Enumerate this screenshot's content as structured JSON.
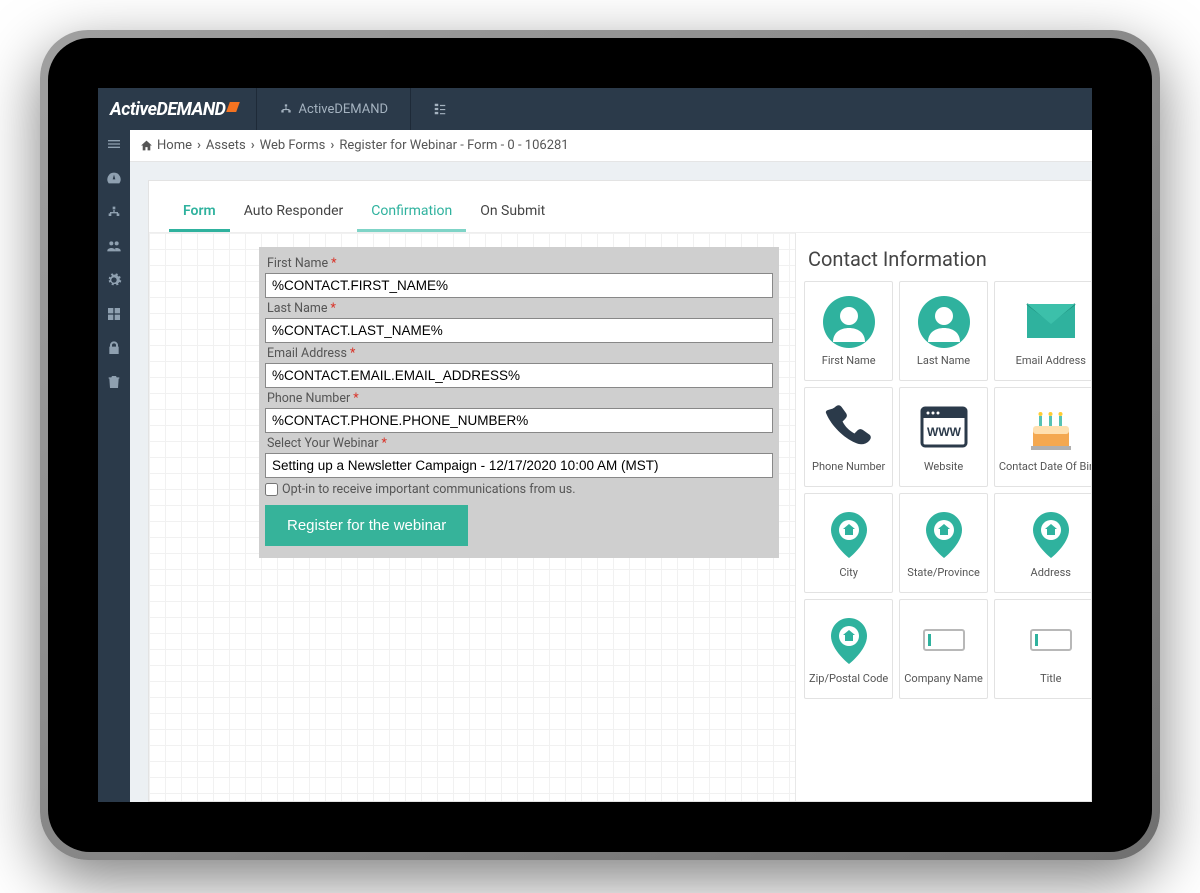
{
  "brand": {
    "name_a": "Active",
    "name_b": "DEMAND"
  },
  "topnav": {
    "item1": "ActiveDEMAND"
  },
  "breadcrumb": {
    "home": "Home",
    "assets": "Assets",
    "webforms": "Web Forms",
    "current": "Register for Webinar - Form - 0 - 106281"
  },
  "tabs": {
    "form": "Form",
    "autoresponder": "Auto Responder",
    "confirmation": "Confirmation",
    "onsubmit": "On Submit"
  },
  "form": {
    "first_name": {
      "label": "First Name",
      "value": "%CONTACT.FIRST_NAME%"
    },
    "last_name": {
      "label": "Last Name",
      "value": "%CONTACT.LAST_NAME%"
    },
    "email": {
      "label": "Email Address",
      "value": "%CONTACT.EMAIL.EMAIL_ADDRESS%"
    },
    "phone": {
      "label": "Phone Number",
      "value": "%CONTACT.PHONE.PHONE_NUMBER%"
    },
    "webinar": {
      "label": "Select Your Webinar",
      "value": "Setting up a Newsletter Campaign - 12/17/2020 10:00 AM (MST)"
    },
    "optin": "Opt-in to receive important communications from us.",
    "submit": "Register for the webinar"
  },
  "sidepanel": {
    "title": "Contact Information",
    "tiles": [
      {
        "label": "First Name",
        "icon": "person"
      },
      {
        "label": "Last Name",
        "icon": "person"
      },
      {
        "label": "Email Address",
        "icon": "envelope"
      },
      {
        "label": "Phone Number",
        "icon": "phone"
      },
      {
        "label": "Website",
        "icon": "www"
      },
      {
        "label": "Contact Date Of Birth",
        "icon": "cake"
      },
      {
        "label": "City",
        "icon": "pin"
      },
      {
        "label": "State/Province",
        "icon": "pin"
      },
      {
        "label": "Address",
        "icon": "pin"
      },
      {
        "label": "Zip/Postal Code",
        "icon": "pin"
      },
      {
        "label": "Company Name",
        "icon": "field"
      },
      {
        "label": "Title",
        "icon": "field"
      }
    ]
  }
}
